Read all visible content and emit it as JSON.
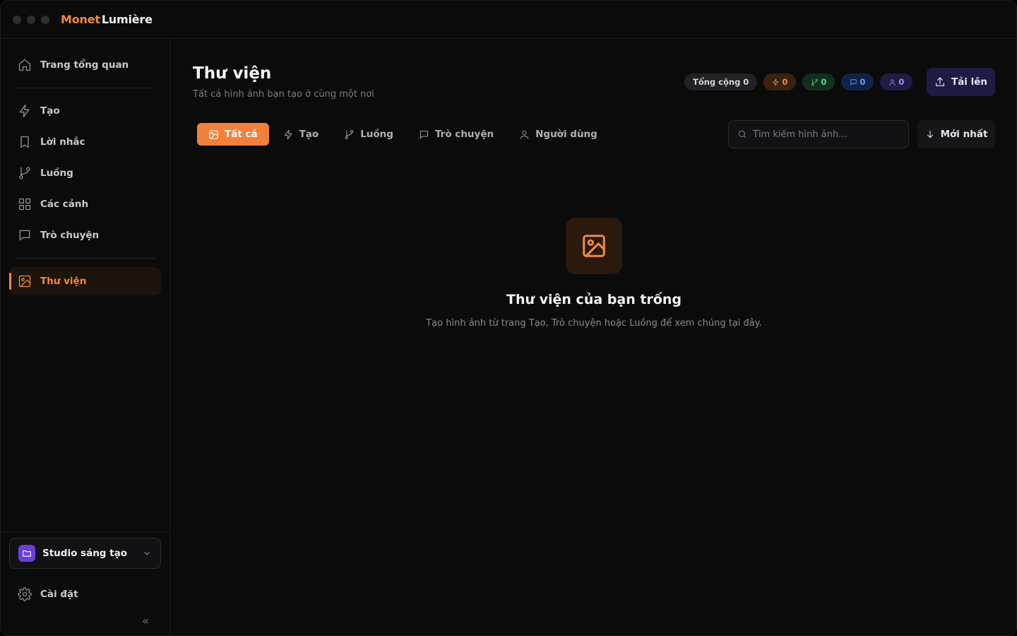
{
  "app": {
    "brand_part1": "Monet",
    "brand_part2": "Lumière",
    "accent_color": "#f08a3c"
  },
  "sidebar": {
    "items": [
      {
        "label": "Trang tổng quan",
        "icon": "home-icon"
      },
      {
        "label": "Tạo",
        "icon": "lightning-icon"
      },
      {
        "label": "Lời nhắc",
        "icon": "bookmark-icon"
      },
      {
        "label": "Luồng",
        "icon": "git-branch-icon"
      },
      {
        "label": "Các cảnh",
        "icon": "grid-icon"
      },
      {
        "label": "Trò chuyện",
        "icon": "chat-icon"
      },
      {
        "label": "Thư viện",
        "icon": "image-icon",
        "active": true
      }
    ],
    "workspace": {
      "label": "Studio sáng tạo",
      "icon": "folder-icon"
    },
    "settings_label": "Cài đặt",
    "collapse_glyph": "«"
  },
  "header": {
    "title": "Thư viện",
    "subtitle": "Tất cả hình ảnh bạn tạo ở cùng một nơi",
    "stats": {
      "total_label": "Tổng cộng 0",
      "generate_count": "0",
      "flow_count": "0",
      "chat_count": "0",
      "user_count": "0"
    },
    "upload_label": "Tải lên"
  },
  "filters": {
    "tabs": [
      {
        "label": "Tất cả",
        "icon": "image-icon",
        "active": true
      },
      {
        "label": "Tạo",
        "icon": "lightning-icon"
      },
      {
        "label": "Luồng",
        "icon": "git-branch-icon"
      },
      {
        "label": "Trò chuyện",
        "icon": "chat-icon"
      },
      {
        "label": "Người dùng",
        "icon": "user-icon"
      }
    ],
    "search_placeholder": "Tìm kiếm hình ảnh...",
    "sort_label": "Mới nhất"
  },
  "empty_state": {
    "title": "Thư viện của bạn trống",
    "message": "Tạo hình ảnh từ trang Tạo, Trò chuyện hoặc Luồng để xem chúng tại đây."
  }
}
